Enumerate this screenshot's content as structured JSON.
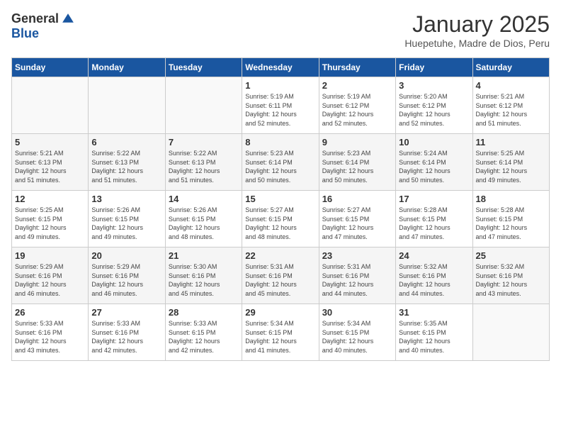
{
  "header": {
    "logo_line1": "General",
    "logo_line2": "Blue",
    "title": "January 2025",
    "subtitle": "Huepetuhe, Madre de Dios, Peru"
  },
  "weekdays": [
    "Sunday",
    "Monday",
    "Tuesday",
    "Wednesday",
    "Thursday",
    "Friday",
    "Saturday"
  ],
  "weeks": [
    [
      {
        "day": "",
        "info": ""
      },
      {
        "day": "",
        "info": ""
      },
      {
        "day": "",
        "info": ""
      },
      {
        "day": "1",
        "info": "Sunrise: 5:19 AM\nSunset: 6:11 PM\nDaylight: 12 hours\nand 52 minutes."
      },
      {
        "day": "2",
        "info": "Sunrise: 5:19 AM\nSunset: 6:12 PM\nDaylight: 12 hours\nand 52 minutes."
      },
      {
        "day": "3",
        "info": "Sunrise: 5:20 AM\nSunset: 6:12 PM\nDaylight: 12 hours\nand 52 minutes."
      },
      {
        "day": "4",
        "info": "Sunrise: 5:21 AM\nSunset: 6:12 PM\nDaylight: 12 hours\nand 51 minutes."
      }
    ],
    [
      {
        "day": "5",
        "info": "Sunrise: 5:21 AM\nSunset: 6:13 PM\nDaylight: 12 hours\nand 51 minutes."
      },
      {
        "day": "6",
        "info": "Sunrise: 5:22 AM\nSunset: 6:13 PM\nDaylight: 12 hours\nand 51 minutes."
      },
      {
        "day": "7",
        "info": "Sunrise: 5:22 AM\nSunset: 6:13 PM\nDaylight: 12 hours\nand 51 minutes."
      },
      {
        "day": "8",
        "info": "Sunrise: 5:23 AM\nSunset: 6:14 PM\nDaylight: 12 hours\nand 50 minutes."
      },
      {
        "day": "9",
        "info": "Sunrise: 5:23 AM\nSunset: 6:14 PM\nDaylight: 12 hours\nand 50 minutes."
      },
      {
        "day": "10",
        "info": "Sunrise: 5:24 AM\nSunset: 6:14 PM\nDaylight: 12 hours\nand 50 minutes."
      },
      {
        "day": "11",
        "info": "Sunrise: 5:25 AM\nSunset: 6:14 PM\nDaylight: 12 hours\nand 49 minutes."
      }
    ],
    [
      {
        "day": "12",
        "info": "Sunrise: 5:25 AM\nSunset: 6:15 PM\nDaylight: 12 hours\nand 49 minutes."
      },
      {
        "day": "13",
        "info": "Sunrise: 5:26 AM\nSunset: 6:15 PM\nDaylight: 12 hours\nand 49 minutes."
      },
      {
        "day": "14",
        "info": "Sunrise: 5:26 AM\nSunset: 6:15 PM\nDaylight: 12 hours\nand 48 minutes."
      },
      {
        "day": "15",
        "info": "Sunrise: 5:27 AM\nSunset: 6:15 PM\nDaylight: 12 hours\nand 48 minutes."
      },
      {
        "day": "16",
        "info": "Sunrise: 5:27 AM\nSunset: 6:15 PM\nDaylight: 12 hours\nand 47 minutes."
      },
      {
        "day": "17",
        "info": "Sunrise: 5:28 AM\nSunset: 6:15 PM\nDaylight: 12 hours\nand 47 minutes."
      },
      {
        "day": "18",
        "info": "Sunrise: 5:28 AM\nSunset: 6:15 PM\nDaylight: 12 hours\nand 47 minutes."
      }
    ],
    [
      {
        "day": "19",
        "info": "Sunrise: 5:29 AM\nSunset: 6:16 PM\nDaylight: 12 hours\nand 46 minutes."
      },
      {
        "day": "20",
        "info": "Sunrise: 5:29 AM\nSunset: 6:16 PM\nDaylight: 12 hours\nand 46 minutes."
      },
      {
        "day": "21",
        "info": "Sunrise: 5:30 AM\nSunset: 6:16 PM\nDaylight: 12 hours\nand 45 minutes."
      },
      {
        "day": "22",
        "info": "Sunrise: 5:31 AM\nSunset: 6:16 PM\nDaylight: 12 hours\nand 45 minutes."
      },
      {
        "day": "23",
        "info": "Sunrise: 5:31 AM\nSunset: 6:16 PM\nDaylight: 12 hours\nand 44 minutes."
      },
      {
        "day": "24",
        "info": "Sunrise: 5:32 AM\nSunset: 6:16 PM\nDaylight: 12 hours\nand 44 minutes."
      },
      {
        "day": "25",
        "info": "Sunrise: 5:32 AM\nSunset: 6:16 PM\nDaylight: 12 hours\nand 43 minutes."
      }
    ],
    [
      {
        "day": "26",
        "info": "Sunrise: 5:33 AM\nSunset: 6:16 PM\nDaylight: 12 hours\nand 43 minutes."
      },
      {
        "day": "27",
        "info": "Sunrise: 5:33 AM\nSunset: 6:16 PM\nDaylight: 12 hours\nand 42 minutes."
      },
      {
        "day": "28",
        "info": "Sunrise: 5:33 AM\nSunset: 6:15 PM\nDaylight: 12 hours\nand 42 minutes."
      },
      {
        "day": "29",
        "info": "Sunrise: 5:34 AM\nSunset: 6:15 PM\nDaylight: 12 hours\nand 41 minutes."
      },
      {
        "day": "30",
        "info": "Sunrise: 5:34 AM\nSunset: 6:15 PM\nDaylight: 12 hours\nand 40 minutes."
      },
      {
        "day": "31",
        "info": "Sunrise: 5:35 AM\nSunset: 6:15 PM\nDaylight: 12 hours\nand 40 minutes."
      },
      {
        "day": "",
        "info": ""
      }
    ]
  ]
}
